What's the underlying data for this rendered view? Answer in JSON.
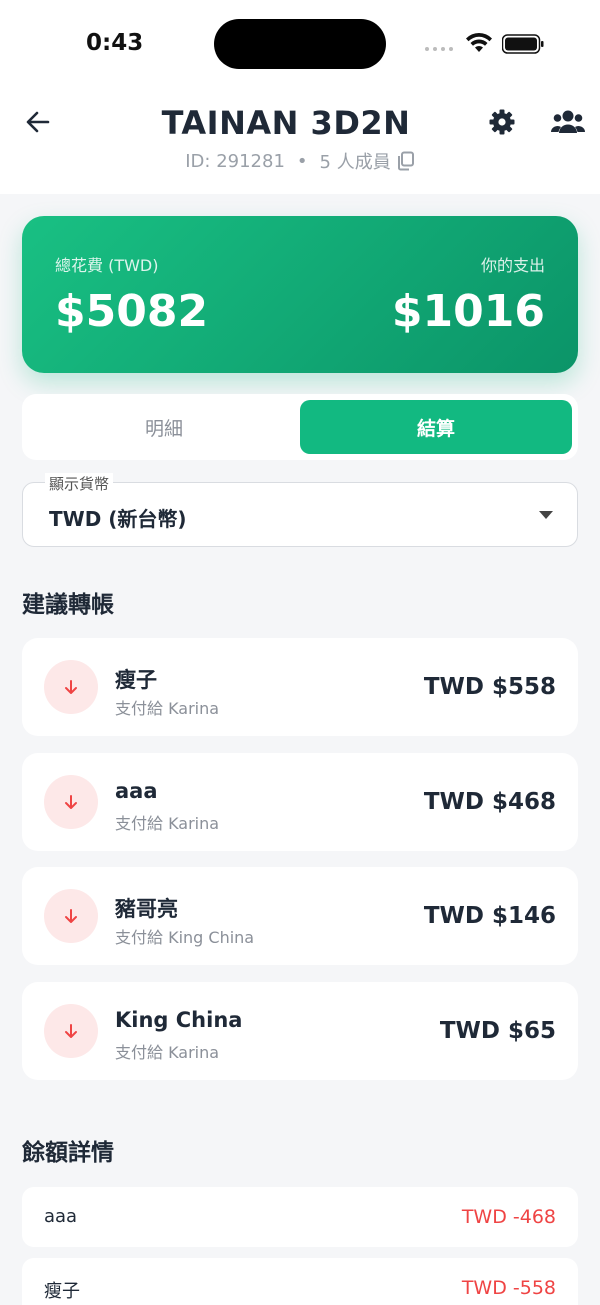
{
  "status_bar": {
    "time": "0:43"
  },
  "header": {
    "title": "TAINAN 3D2N",
    "trip_id": "ID: 291281",
    "separator": "•",
    "members": "5 人成員"
  },
  "summary": {
    "total_label": "總花費 (TWD)",
    "total_amount": "$5082",
    "mine_label": "你的支出",
    "mine_amount": "$1016"
  },
  "tabs": [
    {
      "label": "明細",
      "active": false
    },
    {
      "label": "結算",
      "active": true
    }
  ],
  "currency_select": {
    "label": "顯示貨幣",
    "value": "TWD (新台幣)"
  },
  "transfers": {
    "title": "建議轉帳",
    "items": [
      {
        "name": "瘦子",
        "sub": "支付給 Karina",
        "amount": "TWD $558"
      },
      {
        "name": "aaa",
        "sub": "支付給 Karina",
        "amount": "TWD $468"
      },
      {
        "name": "豬哥亮",
        "sub": "支付給 King China",
        "amount": "TWD $146"
      },
      {
        "name": "King China",
        "sub": "支付給 Karina",
        "amount": "TWD $65"
      }
    ]
  },
  "balances": {
    "title": "餘額詳情",
    "items": [
      {
        "name": "aaa",
        "amount": "TWD -468"
      },
      {
        "name": "瘦子",
        "amount": "TWD -558"
      }
    ]
  },
  "colors": {
    "accent": "#12b981",
    "negative": "#ef4444",
    "icon_bg": "#fde8e8"
  }
}
